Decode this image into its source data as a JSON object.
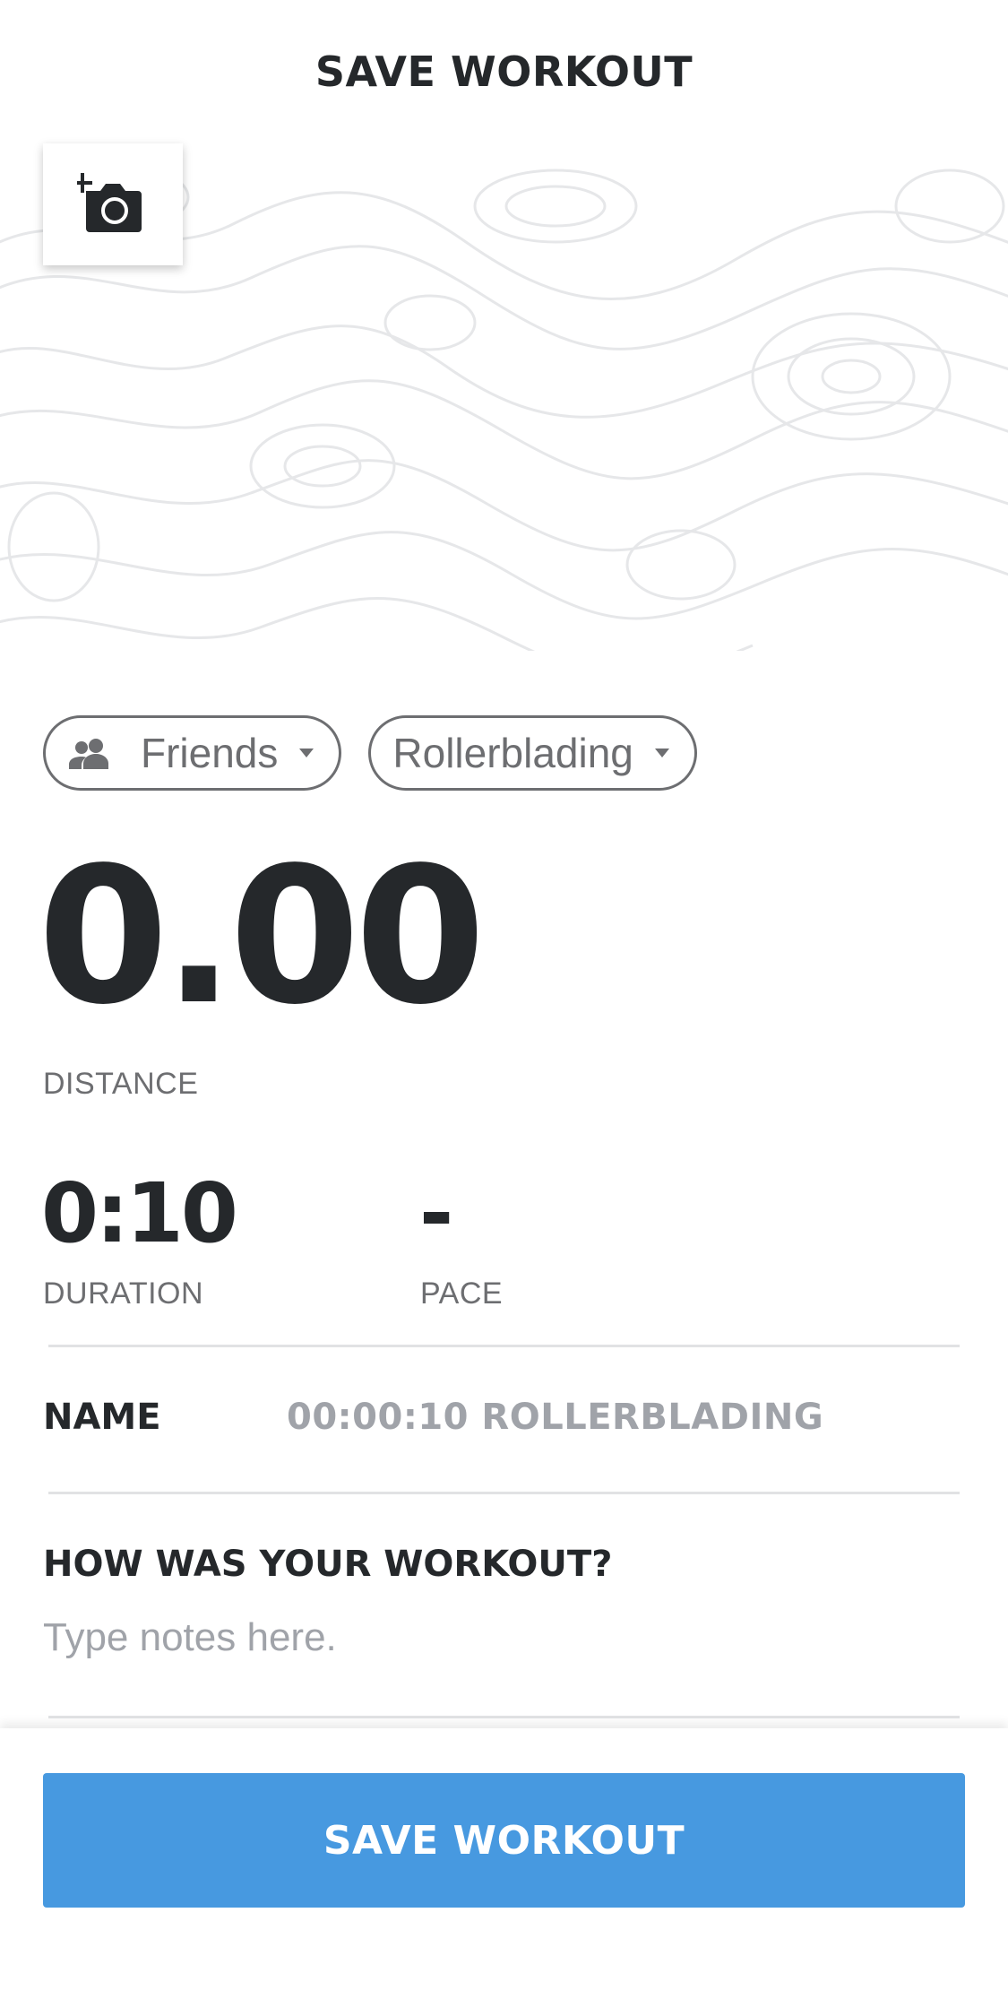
{
  "header": {
    "title": "SAVE WORKOUT"
  },
  "photo": {
    "icon": "add-photo-icon"
  },
  "filters": {
    "privacy": {
      "label": "Friends",
      "icon": "people-icon"
    },
    "activity": {
      "label": "Rollerblading"
    }
  },
  "stats": {
    "distance": {
      "value": "0.00",
      "label": "DISTANCE"
    },
    "duration": {
      "value": "0:10",
      "label": "DURATION"
    },
    "pace": {
      "value": "-",
      "label": "PACE"
    }
  },
  "name_row": {
    "label": "NAME",
    "value": "00:00:10 ROLLERBLADING"
  },
  "notes": {
    "heading": "HOW WAS YOUR WORKOUT?",
    "placeholder": "Type notes here."
  },
  "footer": {
    "save_label": "SAVE WORKOUT"
  },
  "colors": {
    "accent": "#4799e0",
    "text": "#25282b",
    "muted": "#6d6e71",
    "placeholder": "#a0a3a9",
    "divider": "#e1e2e4"
  }
}
